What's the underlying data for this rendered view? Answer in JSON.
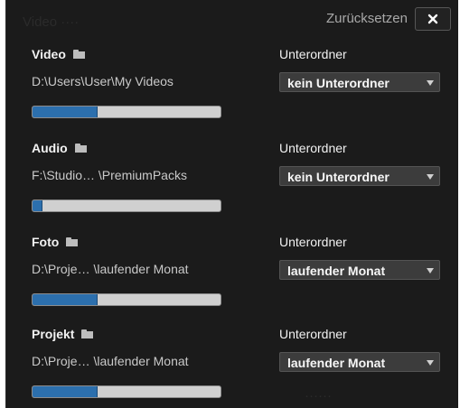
{
  "header": {
    "reset_label": "Zurücksetzen",
    "close_icon": "close-icon"
  },
  "sections": [
    {
      "label": "Video",
      "icon": "folder-icon",
      "path": "D:\\Users\\User\\My Videos",
      "progress": 0.34,
      "subfolder_label": "Unterordner",
      "subfolder_value": "kein Unterordner"
    },
    {
      "label": "Audio",
      "icon": "folder-icon",
      "path": "F:\\Studio… \\PremiumPacks",
      "progress": 0.05,
      "subfolder_label": "Unterordner",
      "subfolder_value": "kein Unterordner"
    },
    {
      "label": "Foto",
      "icon": "folder-icon",
      "path": "D:\\Proje… \\laufender Monat",
      "progress": 0.34,
      "subfolder_label": "Unterordner",
      "subfolder_value": "laufender Monat"
    },
    {
      "label": "Projekt",
      "icon": "folder-icon",
      "path": "D:\\Proje… \\laufender Monat",
      "progress": 0.34,
      "subfolder_label": "Unterordner",
      "subfolder_value": "laufender Monat"
    }
  ],
  "colors": {
    "panel_bg": "#1b1b1b",
    "progress_fill": "#2c6fad",
    "progress_track": "#d0d0d0"
  }
}
